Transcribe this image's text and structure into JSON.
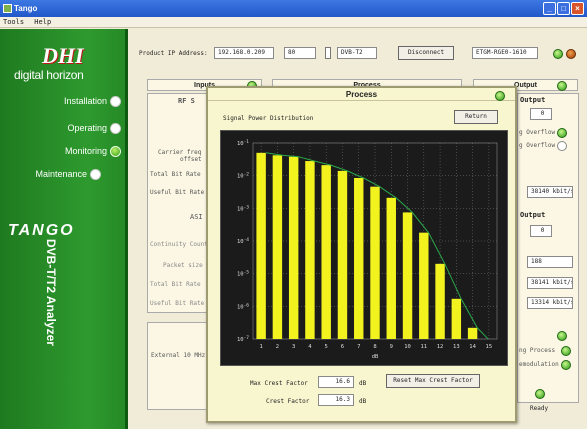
{
  "window": {
    "title": "Tango"
  },
  "menu": [
    "Tools",
    "Help"
  ],
  "sidebar": {
    "logo_mark": "DHI",
    "logo_text": "digital horizon",
    "items": [
      {
        "label": "Installation",
        "active": false
      },
      {
        "label": "Operating",
        "active": false
      },
      {
        "label": "Monitoring",
        "active": true
      },
      {
        "label": "Maintenance",
        "active": false
      }
    ],
    "product": "TANGO",
    "subtitle": "DVB-T/T2 Analyzer"
  },
  "toolbar": {
    "ip_label": "Product IP Address:",
    "ip_value": "192.168.0.209",
    "port_value": "80",
    "standard_value": "DVB-T2",
    "disconnect_label": "Disconnect",
    "serial_value": "ETGM-RGE0-1610"
  },
  "background": {
    "inputs_header": "Inputs",
    "process_header": "Process",
    "output_header": "Output",
    "rf_label": "RF S",
    "carrier_freq": "Carrier freq",
    "offset": "offset",
    "total_bitrate": "Total Bit Rate",
    "useful_bitrate": "Useful Bit Rate",
    "asi": "ASI",
    "continuity": "Continuity Count",
    "packet_size": "Packet size",
    "total_bitrate2": "Total Bit Rate",
    "useful_bitrate2": "Useful Bit Rate",
    "external": "External 10 MHz",
    "right_output1": "Output",
    "right_value1": "0",
    "overflow1": "g Overflow",
    "overflow2": "g Overflow",
    "rate1": "38140 kbit/s",
    "right_output2": "Output",
    "right_value2": "0",
    "right_188": "188",
    "rate2": "38141 kbit/s",
    "rate3": "13314 kbit/s",
    "process_label": "ng Process",
    "demod_label": "emodulation",
    "ready": "Ready"
  },
  "dialog": {
    "title": "Process",
    "subtitle": "Signal Power Distribution",
    "return_label": "Return",
    "max_crest_label": "Max Crest Factor",
    "max_crest_value": "16.6",
    "crest_label": "Crest Factor",
    "crest_value": "16.3",
    "unit": "dB",
    "reset_label": "Reset Max Crest Factor"
  },
  "chart_data": {
    "type": "bar",
    "title": "Signal Power Distribution",
    "xlabel": "dB",
    "ylabel": "",
    "y_scale": "log",
    "ylim": [
      1e-07,
      0.1
    ],
    "y_ticks": [
      "10^-1",
      "10^-2",
      "10^-3",
      "10^-4",
      "10^-5",
      "10^-6",
      "10^-7"
    ],
    "categories": [
      "1",
      "2",
      "3",
      "4",
      "5",
      "6",
      "7",
      "8",
      "9",
      "10",
      "11",
      "12",
      "13",
      "14",
      "15"
    ],
    "values": [
      0.05,
      0.042,
      0.038,
      0.028,
      0.021,
      0.014,
      0.0085,
      0.0046,
      0.0021,
      0.00075,
      0.00018,
      2e-05,
      1.7e-06,
      2.2e-07,
      null
    ],
    "bar_color": "#f1f21e",
    "curve_color": "#2aa84a",
    "background_color": "#1b1b1b",
    "grid": true,
    "grid_style": "dotted"
  }
}
